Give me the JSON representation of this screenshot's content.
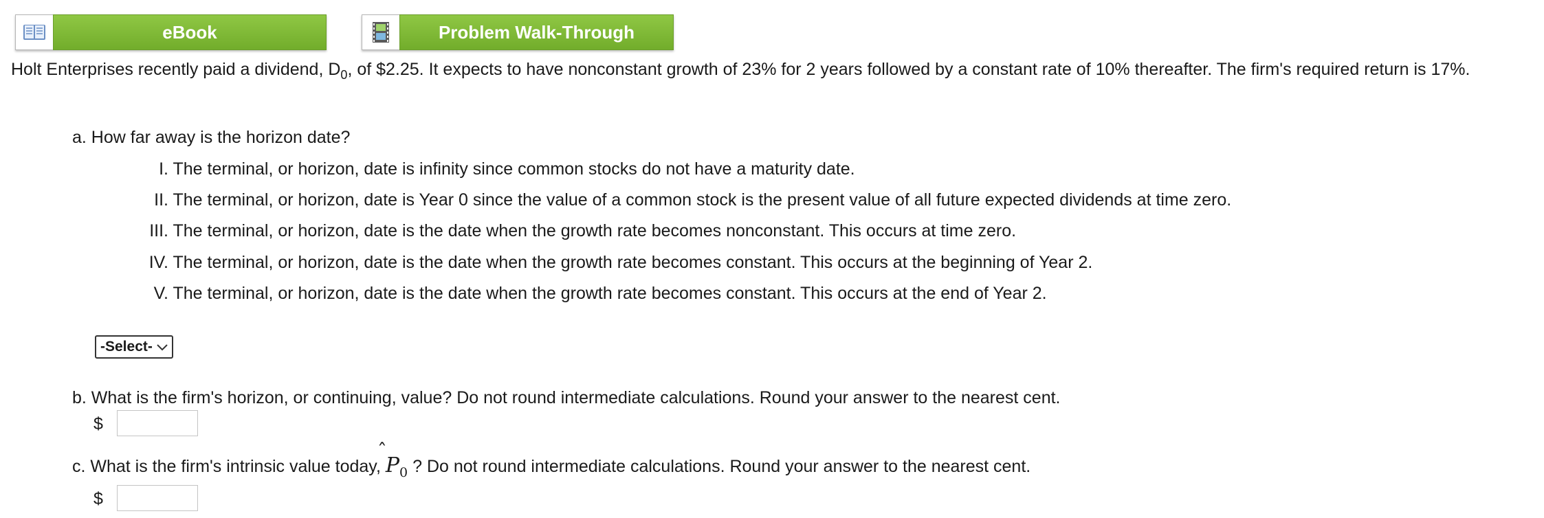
{
  "toolbar": {
    "ebook_label": "eBook",
    "walkthrough_label": "Problem Walk-Through"
  },
  "intro": {
    "part1": "Holt Enterprises recently paid a dividend, D",
    "sub": "0",
    "part2": ", of $2.25. It expects to have nonconstant growth of 23% for 2 years followed by a constant rate of 10% thereafter. The firm's required return is 17%."
  },
  "question_a": {
    "text": "a. How far away is the horizon date?",
    "options": [
      {
        "roman": "I.",
        "text": "The terminal, or horizon, date is infinity since common stocks do not have a maturity date."
      },
      {
        "roman": "II.",
        "text": "The terminal, or horizon, date is Year 0 since the value of a common stock is the present value of all future expected dividends at time zero."
      },
      {
        "roman": "III.",
        "text": "The terminal, or horizon, date is the date when the growth rate becomes nonconstant. This occurs at time zero."
      },
      {
        "roman": "IV.",
        "text": "The terminal, or horizon, date is the date when the growth rate becomes constant. This occurs at the beginning of Year 2."
      },
      {
        "roman": "V.",
        "text": "The terminal, or horizon, date is the date when the growth rate becomes constant. This occurs at the end of Year 2."
      }
    ],
    "select_value": "-Select-"
  },
  "question_b": {
    "text": "b. What is the firm's horizon, or continuing, value? Do not round intermediate calculations. Round your answer to the nearest cent.",
    "currency": "$",
    "answer_value": ""
  },
  "question_c": {
    "before": "c. What is the firm's intrinsic value today,",
    "symbol": "P",
    "symbol_sub": "0",
    "after": "? Do not round intermediate calculations. Round your answer to the nearest cent.",
    "currency": "$",
    "answer_value": ""
  },
  "icons": {
    "ebook": "book-icon",
    "walkthrough": "film-strip-icon"
  },
  "colors": {
    "button_green": "#7cb834",
    "text": "#1a1a1a"
  }
}
